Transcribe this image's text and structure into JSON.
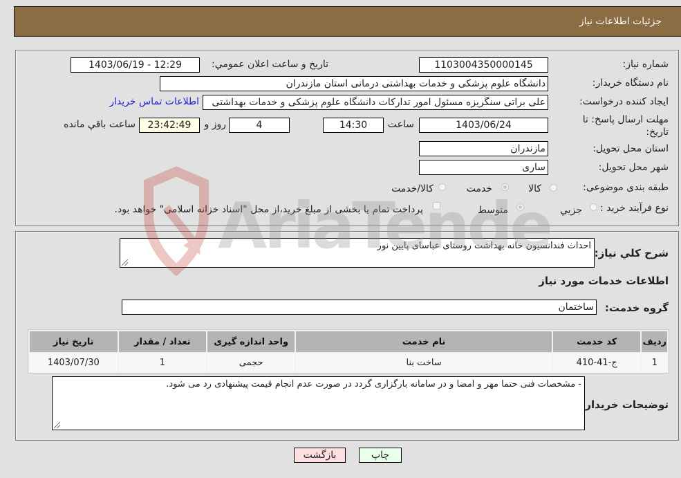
{
  "header": {
    "title": "جزئیات اطلاعات نیاز"
  },
  "need_info": {
    "need_number_label": "شماره نیاز:",
    "need_number": "1103004350000145",
    "announce_label": "تاریخ و ساعت اعلان عمومي:",
    "announce_value": "1403/06/19 - 12:29",
    "buyer_org_label": "نام دستگاه خریدار:",
    "buyer_org": "دانشگاه علوم پزشکی و خدمات بهداشتی  درمانی استان مازندران",
    "creator_label": "ایجاد کننده درخواست:",
    "creator": "علی براتی سنگریزه مسئول امور تدارکات دانشگاه علوم پزشکی و خدمات بهداشتی",
    "contact_link": "اطلاعات تماس خریدار",
    "deadline_label_line1": "مهلت ارسال پاسخ: تا",
    "deadline_label_line2": "تاریخ:",
    "deadline_date": "1403/06/24",
    "time_label": "ساعت",
    "deadline_time": "14:30",
    "days_value": "4",
    "days_label": "روز و",
    "remaining_time": "23:42:49",
    "remaining_label": "ساعت باقي مانده",
    "province_label": "استان محل تحویل:",
    "province": "مازندران",
    "city_label": "شهر محل تحویل:",
    "city": "ساری",
    "category_label": "طبقه بندی موضوعی:",
    "category_options": [
      {
        "label": "کالا",
        "selected": false
      },
      {
        "label": "خدمت",
        "selected": true
      },
      {
        "label": "کالا/خدمت",
        "selected": false
      }
    ],
    "process_label": "نوع فرآیند خرید :",
    "process_options": [
      {
        "label": "جزيي",
        "selected": false
      },
      {
        "label": "متوسط",
        "selected": true
      }
    ],
    "treasury_note": "پرداخت تمام یا بخشی از مبلغ خرید،از محل \"اسناد خزانه اسلامی\" خواهد بود.",
    "treasury_checked": false
  },
  "services": {
    "description_label": "شرح کلي نیاز:",
    "description": "احداث فندانسیون خانه بهداشت روستای عباسای پایین نور",
    "section_title": "اطلاعات خدمات مورد نیاز",
    "group_label": "گروه خدمت:",
    "group_value": "ساختمان",
    "table": {
      "headers": [
        "ردیف",
        "کد خدمت",
        "نام خدمت",
        "واحد اندازه گیری",
        "تعداد / مقدار",
        "تاریخ نیاز"
      ],
      "rows": [
        [
          "1",
          "ج-41-410",
          "ساخت بنا",
          "حجمی",
          "1",
          "1403/07/30"
        ]
      ]
    },
    "buyer_notes_label": "توضیحات خریدار:",
    "buyer_notes": "-  مشخصات فنی حتما مهر و امضا و در سامانه بارگزاری گردد در صورت عدم انجام قیمت پیشنهادی رد می شود."
  },
  "buttons": {
    "print": "چاپ",
    "back": "بازگشت"
  },
  "colors": {
    "header_bg": "#8b6d43",
    "print_bg": "#eaffea",
    "back_bg": "#ffe0e0",
    "link": "#2020d0"
  },
  "watermark": {
    "text": "AriaTender.neT"
  }
}
